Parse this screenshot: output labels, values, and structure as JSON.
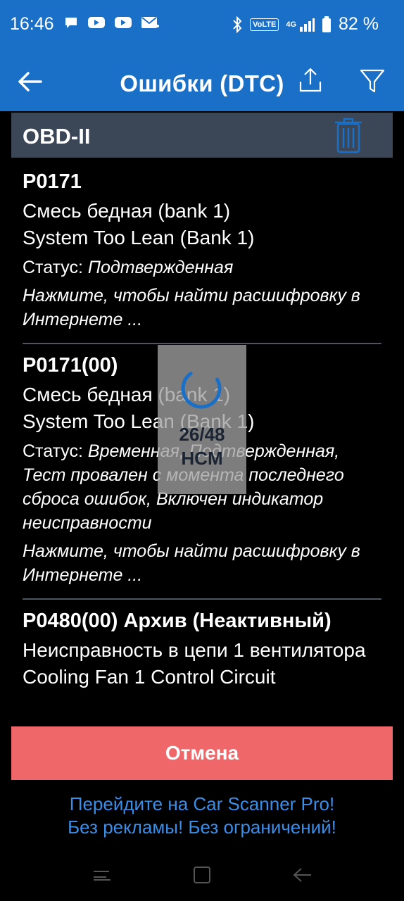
{
  "status_bar": {
    "time": "16:46",
    "battery": "82 %",
    "volte": "VoLTE",
    "network": "4G",
    "icons_left": [
      "chat-icon",
      "youtube-icon",
      "youtube-icon",
      "mail-icon"
    ]
  },
  "app_bar": {
    "title": "Ошибки (DTC)"
  },
  "section": {
    "title": "OBD-II"
  },
  "dtc_items": [
    {
      "code": "P0171",
      "desc_ru": "Смесь бедная (bank 1)",
      "desc_en": "System Too Lean (Bank 1)",
      "status_label": "Статус: ",
      "status_value": "Подтвержденная",
      "hint": "Нажмите, чтобы найти расшифровку в Интернете ..."
    },
    {
      "code": "P0171(00)",
      "desc_ru": "Смесь бедная (bank 1)",
      "desc_en": "System Too Lean (Bank 1)",
      "status_label": "Статус: ",
      "status_value": "Временная, Подтвержденная, Тест провален с момента последнего сброса ошибок, Включен индикатор неисправности",
      "hint": "Нажмите, чтобы найти расшифровку в Интернете ..."
    },
    {
      "code": "P0480(00) Архив (Неактивный)",
      "desc_ru": "Неисправность в цепи 1 вентилятора",
      "desc_en": "Cooling Fan 1 Control Circuit"
    }
  ],
  "loading": {
    "progress": "26/48",
    "module": "HCM"
  },
  "cancel_button": {
    "label": "Отмена"
  },
  "promo": {
    "line1": "Перейдите на Car Scanner Pro!",
    "line2": "Без рекламы! Без ограничений!"
  },
  "colors": {
    "app_bar": "#1a6fc7",
    "section_bg": "#3b4656",
    "cancel_bg": "#f0676a",
    "promo_text": "#3b8ee8",
    "trash_icon": "#1a6fc7"
  }
}
